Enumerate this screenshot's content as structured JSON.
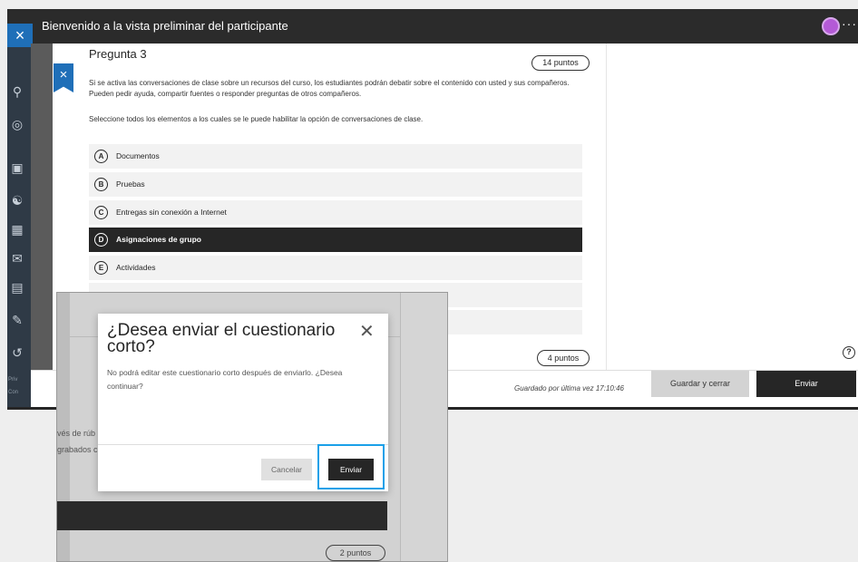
{
  "topbar": {
    "title": "Bienvenido a la vista preliminar del participante",
    "close_glyph": "×",
    "more_glyph": "···"
  },
  "question": {
    "title": "Pregunta 3",
    "points": "14 puntos",
    "body": "Si se activa las conversaciones de clase sobre un recursos del curso, los estudiantes podrán debatir sobre el contenido con usted y sus compañeros. Pueden pedir ayuda, compartir fuentes o responder preguntas de otros compañeros.",
    "instruction": "Seleccione todos los elementos a los cuales se le puede habilitar la opción de conversaciones de clase.",
    "options": [
      {
        "letter": "A",
        "label": "Documentos"
      },
      {
        "letter": "B",
        "label": "Pruebas"
      },
      {
        "letter": "C",
        "label": "Entregas sin conexión a Internet"
      },
      {
        "letter": "D",
        "label": "Asignaciones de grupo"
      },
      {
        "letter": "E",
        "label": "Actividades"
      }
    ],
    "next_points": "4 puntos"
  },
  "footer": {
    "saved": "Guardado por última vez 17:10:46",
    "save_close": "Guardar y cerrar",
    "submit": "Enviar"
  },
  "sidenav": {
    "privacy": "Priv",
    "contact": "Con"
  },
  "overlay": {
    "fragment_1": "vés de rúb",
    "fragment_2": "grabados c",
    "points": "2 puntos"
  },
  "modal": {
    "title": "¿Desea enviar el cuestionario corto?",
    "body": "No podrá editar este cuestionario corto después de enviarlo. ¿Desea continuar?",
    "cancel": "Cancelar",
    "submit": "Enviar",
    "close_glyph": "✕"
  },
  "colors": {
    "accent": "#1f6fb8",
    "highlight": "#1aa0e8",
    "dark": "#262626"
  },
  "icons": [
    "close-icon",
    "avatar-icon",
    "more-icon",
    "help-icon",
    "user-icon",
    "globe-icon",
    "calendar-icon",
    "mail-icon",
    "grades-icon",
    "logout-icon"
  ]
}
